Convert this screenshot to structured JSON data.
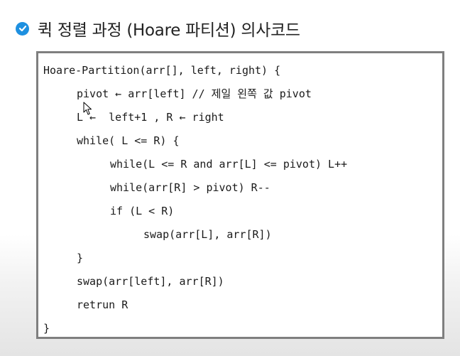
{
  "slide": {
    "title": "퀵 정렬 과정 (Hoare 파티션) 의사코드",
    "title_icon": "check-circle-icon",
    "accent_color": "#1e90e0"
  },
  "code": {
    "lines": [
      "Hoare-Partition(arr[], left, right) {",
      "pivot ← arr[left] // 제일 왼쪽 값 pivot",
      "L ←  left+1 , R ← right",
      "while( L <= R) {",
      "while(L <= R and arr[L] <= pivot) L++",
      "while(arr[R] > pivot) R--",
      "if (L < R)",
      "swap(arr[L], arr[R])",
      "}",
      "swap(arr[left], arr[R])",
      "retrun R",
      "}"
    ]
  }
}
